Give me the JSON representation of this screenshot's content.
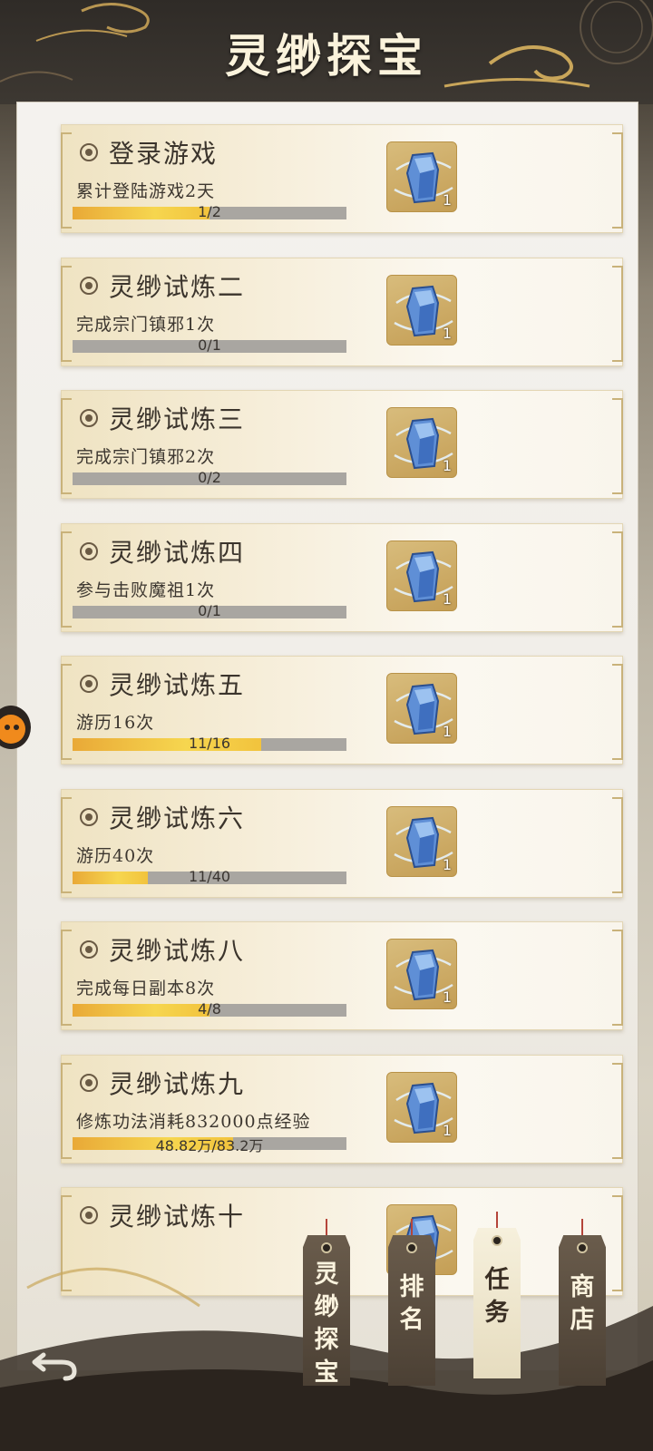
{
  "header": {
    "title": "灵缈探宝"
  },
  "tasks": [
    {
      "title": "登录游戏",
      "desc": "累计登陆游戏2天",
      "progress_text": "1/2",
      "progress": 0.5,
      "reward_qty": "1"
    },
    {
      "title": "灵缈试炼二",
      "desc": "完成宗门镇邪1次",
      "progress_text": "0/1",
      "progress": 0,
      "reward_qty": "1"
    },
    {
      "title": "灵缈试炼三",
      "desc": "完成宗门镇邪2次",
      "progress_text": "0/2",
      "progress": 0,
      "reward_qty": "1"
    },
    {
      "title": "灵缈试炼四",
      "desc": "参与击败魔祖1次",
      "progress_text": "0/1",
      "progress": 0,
      "reward_qty": "1"
    },
    {
      "title": "灵缈试炼五",
      "desc": "游历16次",
      "progress_text": "11/16",
      "progress": 0.6875,
      "reward_qty": "1"
    },
    {
      "title": "灵缈试炼六",
      "desc": "游历40次",
      "progress_text": "11/40",
      "progress": 0.275,
      "reward_qty": "1"
    },
    {
      "title": "灵缈试炼八",
      "desc": "完成每日副本8次",
      "progress_text": "4/8",
      "progress": 0.5,
      "reward_qty": "1"
    },
    {
      "title": "灵缈试炼九",
      "desc": "修炼功法消耗832000点经验",
      "progress_text": "48.82万/83.2万",
      "progress": 0.587,
      "reward_qty": "1"
    },
    {
      "title": "灵缈试炼十",
      "desc": "",
      "progress_text": "",
      "progress": 0,
      "reward_qty": ""
    }
  ],
  "nav_tabs": [
    {
      "label": "灵缈探宝",
      "style": "dark"
    },
    {
      "label": "排名",
      "style": "dark"
    },
    {
      "label": "任务",
      "style": "light"
    },
    {
      "label": "商店",
      "style": "dark"
    }
  ],
  "colors": {
    "accent_gold": "#f2c33d",
    "card_border": "#c9b27a",
    "string_red": "#b5453a"
  },
  "icons": {
    "reward": "spirit-crystal-icon",
    "back": "back-arrow-icon",
    "bullet": "radio-bullet-icon"
  }
}
